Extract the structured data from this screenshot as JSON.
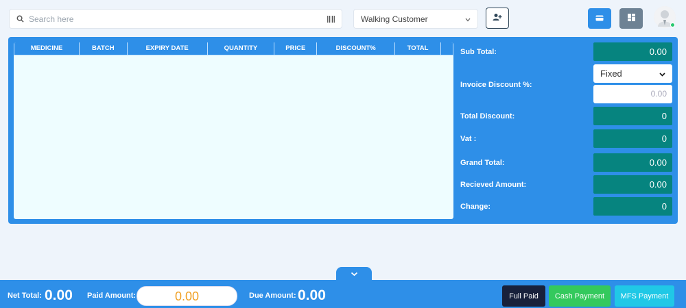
{
  "search": {
    "placeholder": "Search here",
    "icon": "search-icon",
    "scan_icon": "barcode-icon"
  },
  "customer": {
    "selected": "Walking Customer"
  },
  "table": {
    "headers": [
      "MEDICINE",
      "BATCH",
      "EXPIRY DATE",
      "QUANTITY",
      "PRICE",
      "DISCOUNT%",
      "TOTAL"
    ]
  },
  "summary": {
    "sub_total_label": "Sub Total:",
    "sub_total": "0.00",
    "discount_type": "Fixed",
    "invoice_discount_label": "Invoice Discount %:",
    "invoice_discount_placeholder": "0.00",
    "total_discount_label": "Total Discount:",
    "total_discount": "0",
    "vat_label": "Vat :",
    "vat": "0",
    "grand_total_label": "Grand Total:",
    "grand_total": "0.00",
    "received_label": "Recieved Amount:",
    "received": "0.00",
    "change_label": "Change:",
    "change": "0"
  },
  "footer": {
    "net_total_label": "Net Total:",
    "net_total": "0.00",
    "paid_label": "Paid Amount:",
    "paid": "0.00",
    "due_label": "Due Amount:",
    "due": "0.00",
    "full_paid": "Full Paid",
    "cash_payment": "Cash Payment",
    "mfs_payment": "MFS Payment"
  },
  "colors": {
    "primary": "#2e8fe8",
    "teal": "#06847f",
    "dark": "#18213b",
    "green": "#34c95d",
    "cyan": "#20c8e6",
    "orange": "#f0a024"
  }
}
